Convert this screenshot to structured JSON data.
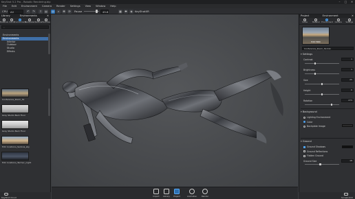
{
  "window": {
    "title": "KeyShot 5.2 Pro - Robotic Rendering.bip",
    "minimize": "–",
    "maximize": "□",
    "close": "✕"
  },
  "menu": [
    "File",
    "Edit",
    "Environment",
    "Camera",
    "Render",
    "Settings",
    "View",
    "Window",
    "Help"
  ],
  "toolbar": {
    "cpu_label": "CPU",
    "cpu_value": "All Cores",
    "pause_label": "Pause",
    "fps_value": "45.8",
    "keyshotxr_label": "KeyShotXR"
  },
  "left_panel": {
    "title": "Library",
    "tab_label": "Environments",
    "tabs": [
      "Materials",
      "Colors",
      "Environments",
      "Backplates",
      "Textures",
      "Favorites"
    ],
    "active_tab_index": 2,
    "search_placeholder": "",
    "tree": [
      {
        "label": "Environments",
        "selected": false,
        "indent": false
      },
      {
        "label": "Environments",
        "selected": true,
        "indent": false
      },
      {
        "label": "Interior",
        "selected": false,
        "indent": true
      },
      {
        "label": "Outdoor",
        "selected": false,
        "indent": true
      },
      {
        "label": "Studio",
        "selected": false,
        "indent": true
      },
      {
        "label": "Effects",
        "selected": false,
        "indent": true
      }
    ],
    "thumbnails": [
      {
        "label": "Conference_Room_3k",
        "colors": [
          "#5e6f82",
          "#b9a27c",
          "#4d4a45"
        ]
      },
      {
        "label": "Grey Studio Back Floor",
        "colors": [
          "#d9d9d9",
          "#bdbdbd",
          "#8d8d8d"
        ]
      },
      {
        "label": "Grey Studio Back Floor",
        "colors": [
          "#e8e8e8",
          "#c8c8c8",
          "#9a9a9a"
        ]
      },
      {
        "label": "Hdri locations_Sedona_sky",
        "colors": [
          "#8fa7c0",
          "#d1b48b",
          "#5f5346"
        ]
      },
      {
        "label": "Hdri locations_Tarmac_night",
        "colors": [
          "#2e3542",
          "#4c5566",
          "#1d1f24"
        ]
      }
    ],
    "footer_label": "KeyShot Cloud"
  },
  "right_panel": {
    "title": "Project",
    "tab_label": "Environment",
    "tabs": [
      "Scene",
      "Material",
      "Environment",
      "Camera",
      "Settings"
    ],
    "active_tab_index": 2,
    "preview_label": "Edit HDRI",
    "env_name": "Conference_Room_3k.hdz",
    "settings_title": "Settings",
    "props": [
      {
        "label": "Contrast",
        "value": "1",
        "level": 0.3
      },
      {
        "label": "Brightness",
        "value": "1",
        "level": 0.3
      },
      {
        "label": "Size",
        "value": "25",
        "level": 0.5
      },
      {
        "label": "Height",
        "value": "0",
        "level": 0.5
      },
      {
        "label": "Rotation",
        "value": "273",
        "level": 0.78
      }
    ],
    "background_title": "Background",
    "background_options": [
      {
        "label": "Lighting Environment",
        "selected": false
      },
      {
        "label": "Color",
        "selected": true
      },
      {
        "label": "Backplate Image",
        "selected": false
      }
    ],
    "background_color": "#2b2b2b",
    "ground_title": "Ground",
    "ground_options": [
      {
        "label": "Ground Shadows",
        "checked": true
      },
      {
        "label": "Ground Reflections",
        "checked": false
      },
      {
        "label": "Flatten Ground",
        "checked": false
      }
    ],
    "shadow_color": "#111111",
    "grid_size_label": "Ground Size",
    "grid_size_value": "18",
    "grid_size_level": 0.45
  },
  "bottombar": {
    "items": [
      "Import",
      "Library",
      "Project",
      "Animation",
      "Render"
    ],
    "active_index": 2
  },
  "status": {
    "left": "KeyShot Cloud",
    "right": "Screenshot"
  },
  "colors": {
    "accent": "#2d6fb0",
    "panel": "#2f3033",
    "viewport": "#4a4c4f"
  }
}
